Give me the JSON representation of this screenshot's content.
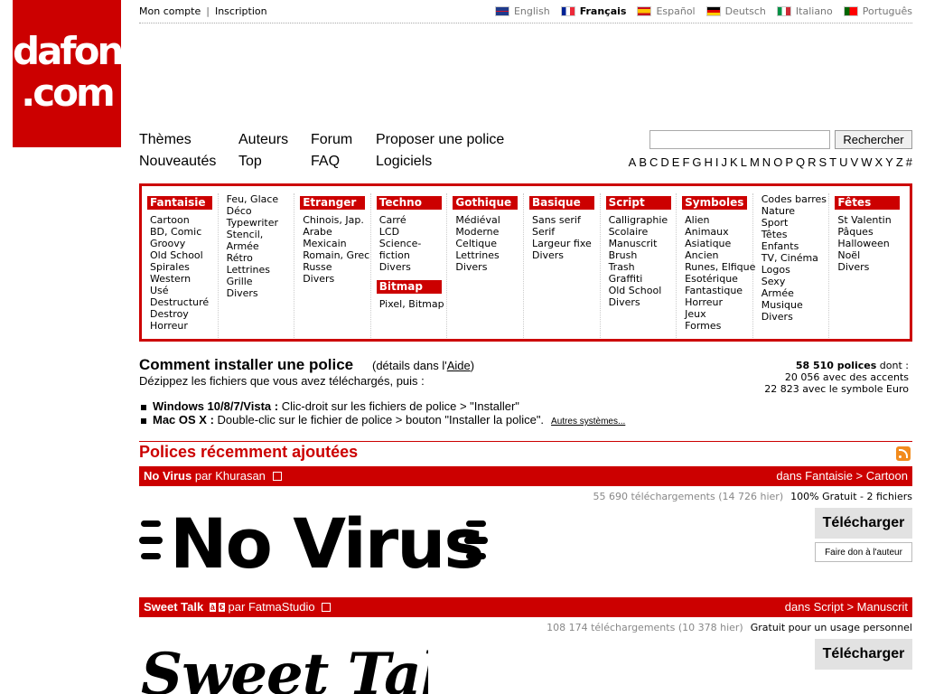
{
  "logo": {
    "line1": "dafont",
    "line2": ".com"
  },
  "account": {
    "my_account": "Mon compte",
    "signup": "Inscription"
  },
  "languages": [
    {
      "label": "English",
      "active": false
    },
    {
      "label": "Français",
      "active": true
    },
    {
      "label": "Español",
      "active": false
    },
    {
      "label": "Deutsch",
      "active": false
    },
    {
      "label": "Italiano",
      "active": false
    },
    {
      "label": "Português",
      "active": false
    }
  ],
  "nav": {
    "themes": "Thèmes",
    "authors": "Auteurs",
    "forum": "Forum",
    "submit": "Proposer une police",
    "new": "Nouveautés",
    "top": "Top",
    "faq": "FAQ",
    "software": "Logiciels"
  },
  "search": {
    "placeholder": "",
    "button": "Rechercher"
  },
  "alphabet": [
    "A",
    "B",
    "C",
    "D",
    "E",
    "F",
    "G",
    "H",
    "I",
    "J",
    "K",
    "L",
    "M",
    "N",
    "O",
    "P",
    "Q",
    "R",
    "S",
    "T",
    "U",
    "V",
    "W",
    "X",
    "Y",
    "Z",
    "#"
  ],
  "categories": [
    {
      "head": "Fantaisie",
      "items": [
        "Cartoon",
        "BD, Comic",
        "Groovy",
        "Old School",
        "Spirales",
        "Western",
        "Usé",
        "Destructuré",
        "Destroy",
        "Horreur"
      ]
    },
    {
      "head": "",
      "items": [
        "Feu, Glace",
        "Déco",
        "Typewriter",
        "Stencil,",
        "Armée",
        "Rétro",
        "Lettrines",
        "Grille",
        "Divers"
      ]
    },
    {
      "head": "Etranger",
      "items": [
        "Chinois, Jap.",
        "Arabe",
        "Mexicain",
        "Romain, Grec",
        "Russe",
        "Divers"
      ]
    },
    {
      "head": "Techno",
      "items": [
        "Carré",
        "LCD",
        "Science-",
        "fiction",
        "Divers"
      ],
      "head2": "Bitmap",
      "items2": [
        "Pixel, Bitmap"
      ]
    },
    {
      "head": "Gothique",
      "items": [
        "Médiéval",
        "Moderne",
        "Celtique",
        "Lettrines",
        "Divers"
      ]
    },
    {
      "head": "Basique",
      "items": [
        "Sans serif",
        "Serif",
        "Largeur fixe",
        "Divers"
      ]
    },
    {
      "head": "Script",
      "items": [
        "Calligraphie",
        "Scolaire",
        "Manuscrit",
        "Brush",
        "Trash",
        "Graffiti",
        "Old School",
        "Divers"
      ]
    },
    {
      "head": "Symboles",
      "items": [
        "Alien",
        "Animaux",
        "Asiatique",
        "Ancien",
        "Runes, Elfique",
        "Esotérique",
        "Fantastique",
        "Horreur",
        "Jeux",
        "Formes"
      ]
    },
    {
      "head": "",
      "items": [
        "Codes barres",
        "Nature",
        "Sport",
        "Têtes",
        "Enfants",
        "TV, Cinéma",
        "Logos",
        "Sexy",
        "Armée",
        "Musique",
        "Divers"
      ]
    },
    {
      "head": "Fêtes",
      "items": [
        "St Valentin",
        "Pâques",
        "Halloween",
        "Noël",
        "Divers"
      ]
    }
  ],
  "install": {
    "title": "Comment installer une police",
    "details_pre": "(détails dans l'",
    "details_link": "Aide",
    "details_post": ")",
    "subtitle": "Dézippez les fichiers que vous avez téléchargés, puis :",
    "windows_label": "Windows 10/8/7/Vista :",
    "windows_text": "Clic-droit sur les fichiers de police > \"Installer\"",
    "mac_label": "Mac OS X :",
    "mac_text": "Double-clic sur le fichier de police > bouton \"Installer la police\".",
    "other_systems": "Autres systèmes..."
  },
  "stats": {
    "total": "58 510 polices",
    "total_suffix": "dont :",
    "accents": "20 056 avec des accents",
    "euro": "22 823 avec le symbole Euro"
  },
  "recent": {
    "title": "Polices récemment ajoutées",
    "fonts": [
      {
        "name": "No Virus",
        "by": "par",
        "author": "Khurasan",
        "category": "dans Fantaisie > Cartoon",
        "downloads": "55 690 téléchargements (14 726 hier)",
        "license": "100% Gratuit - 2 fichiers",
        "download_label": "Télécharger",
        "donate_label": "Faire don à l'auteur",
        "preview": "No Virus"
      },
      {
        "name": "Sweet Talk",
        "by": "par",
        "author": "FatmaStudio",
        "badge1": "à",
        "badge2": "€",
        "category": "dans Script > Manuscrit",
        "downloads": "108 174 téléchargements (10 378 hier)",
        "license": "Gratuit pour un usage personnel",
        "download_label": "Télécharger",
        "preview": "Sweet Talk"
      }
    ]
  },
  "colors": {
    "brand_red": "#cc0000",
    "button_gray": "#e2e2e2"
  }
}
